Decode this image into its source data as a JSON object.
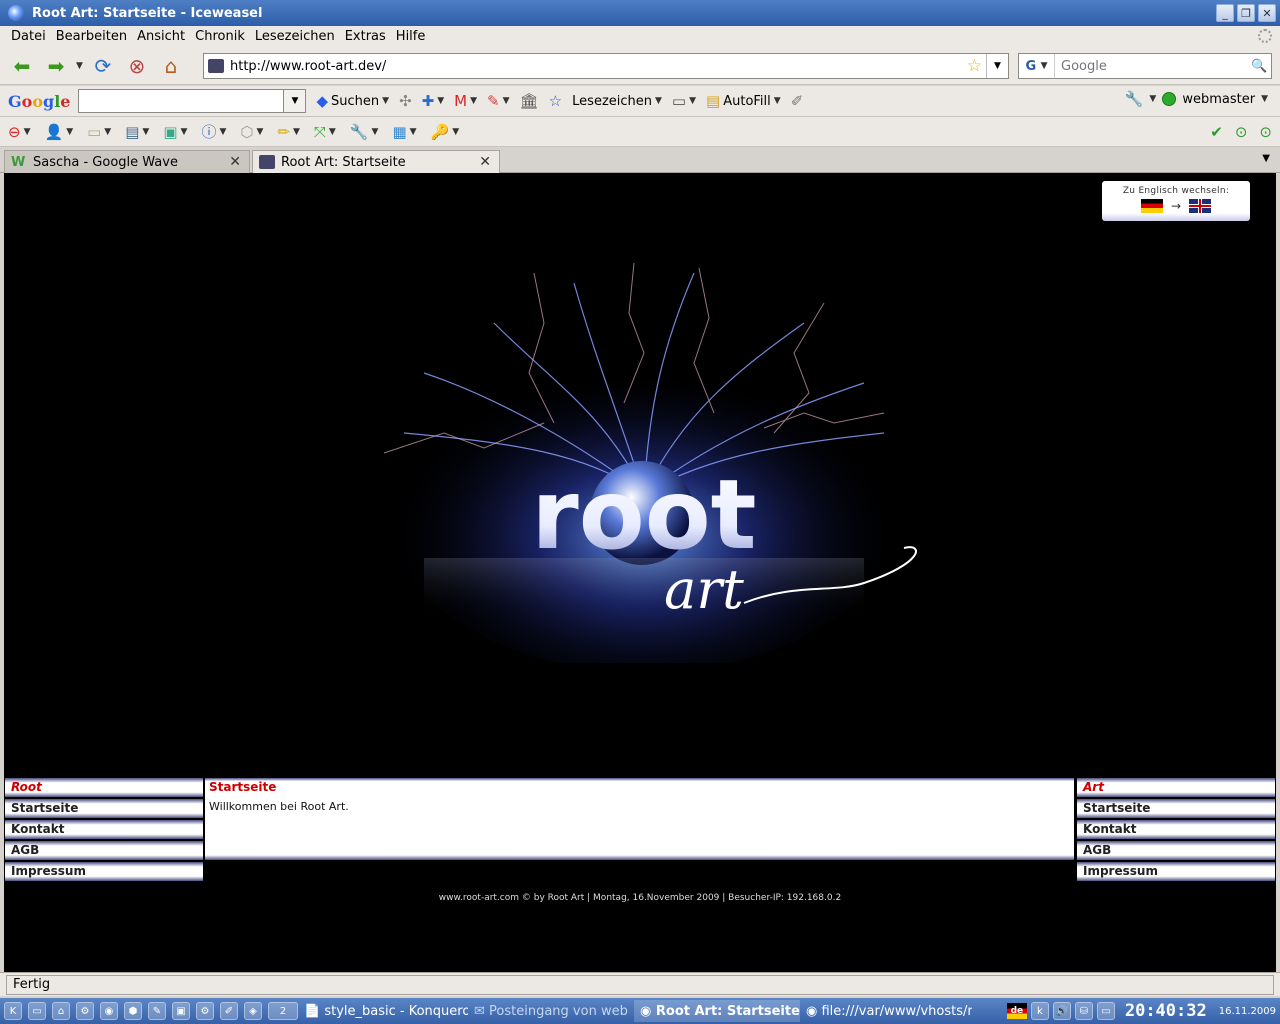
{
  "window": {
    "title": "Root Art: Startseite - Iceweasel"
  },
  "menubar": {
    "items": [
      {
        "label": "Datei"
      },
      {
        "label": "Bearbeiten"
      },
      {
        "label": "Ansicht"
      },
      {
        "label": "Chronik"
      },
      {
        "label": "Lesezeichen"
      },
      {
        "label": "Extras"
      },
      {
        "label": "Hilfe"
      }
    ]
  },
  "navbar": {
    "url": "http://www.root-art.dev/",
    "search_placeholder": "Google",
    "search_engine_icon": "G"
  },
  "googlebar": {
    "logo": "Google",
    "search_label": "Suchen",
    "bookmarks_label": "Lesezeichen",
    "autofill_label": "AutoFill",
    "account_label": "webmaster"
  },
  "tabs": [
    {
      "label": "Sascha - Google Wave"
    },
    {
      "label": "Root Art: Startseite"
    }
  ],
  "page": {
    "lang_switch_label": "Zu Englisch wechseln:",
    "lang_arrow": "→",
    "logo_text": "root",
    "logo_script": "art",
    "left_menu": {
      "heading": "Root",
      "items": [
        "Startseite",
        "Kontakt",
        "AGB",
        "Impressum"
      ]
    },
    "right_menu": {
      "heading": "Art",
      "items": [
        "Startseite",
        "Kontakt",
        "AGB",
        "Impressum"
      ]
    },
    "content": {
      "heading": "Startseite",
      "body": "Willkommen bei Root Art."
    },
    "footer": "www.root-art.com © by  Root Art | Montag, 16.November 2009 | Besucher-IP: 192.168.0.2"
  },
  "statusbar": {
    "text": "Fertig"
  },
  "taskbar": {
    "desktop_pager": "2",
    "tasks": [
      {
        "label": "style_basic - Konqueror",
        "state": "normal"
      },
      {
        "label": "Posteingang von web",
        "state": "dim"
      },
      {
        "label": "Root Art: Startseite",
        "state": "active"
      },
      {
        "label": "file:///var/www/vhosts/ro",
        "state": "normal"
      }
    ],
    "keyboard_layout": "de",
    "clock": "20:40:32",
    "date": "16.11.2009"
  }
}
